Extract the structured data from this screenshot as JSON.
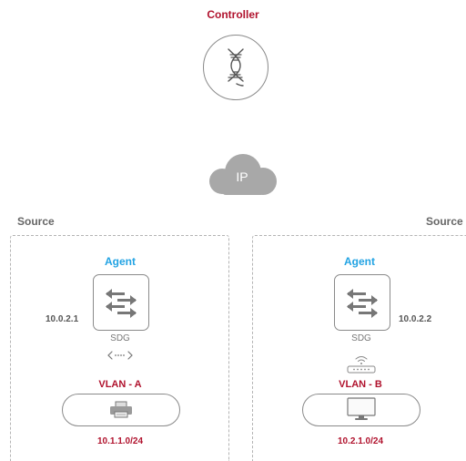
{
  "controller": {
    "title": "Controller",
    "icon": "dna-helix-icon"
  },
  "network": {
    "label": "IP",
    "icon": "cloud-icon"
  },
  "sources": [
    {
      "label": "Source",
      "agent": "Agent",
      "ip": "10.0.2.1",
      "device_label": "SDG",
      "link_icon": "dotted-arrows-icon",
      "vlan": "VLAN - A",
      "endpoint_icon": "printer-icon",
      "subnet": "10.1.1.0/24"
    },
    {
      "label": "Source",
      "agent": "Agent",
      "ip": "10.0.2.2",
      "device_label": "SDG",
      "link_icon": "wifi-router-icon",
      "vlan": "VLAN - B",
      "endpoint_icon": "monitor-icon",
      "subnet": "10.2.1.0/24"
    }
  ],
  "colors": {
    "accent_red": "#b0122d",
    "agent_blue": "#22a3e3",
    "cloud_gray": "#a8a8a8",
    "line_gray": "#8a8a8a"
  }
}
